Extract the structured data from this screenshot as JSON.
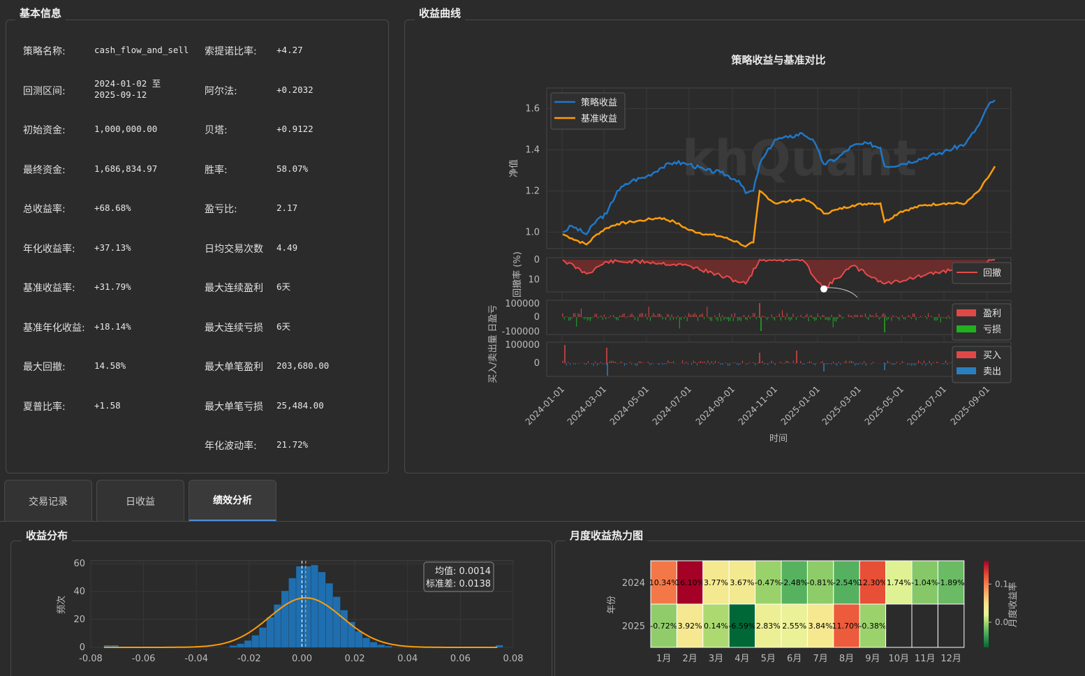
{
  "panels": {
    "basic_title": "基本信息",
    "curve_title": "收益曲线",
    "dist_title": "收益分布",
    "heat_title": "月度收益热力图"
  },
  "stats_left": [
    {
      "label": "策略名称:",
      "value": "cash_flow_and_sell"
    },
    {
      "label": "回测区间:",
      "value": "2024-01-02 至\n2025-09-12"
    },
    {
      "label": "初始资金:",
      "value": "1,000,000.00"
    },
    {
      "label": "最终资金:",
      "value": "1,686,834.97"
    },
    {
      "label": "总收益率:",
      "value": "+68.68%"
    },
    {
      "label": "年化收益率:",
      "value": "+37.13%"
    },
    {
      "label": "基准收益率:",
      "value": "+31.79%"
    },
    {
      "label": "基准年化收益:",
      "value": "+18.14%"
    },
    {
      "label": "最大回撤:",
      "value": "14.58%"
    },
    {
      "label": "夏普比率:",
      "value": "+1.58"
    }
  ],
  "stats_right": [
    {
      "label": "索提诺比率:",
      "value": "+4.27"
    },
    {
      "label": "阿尔法:",
      "value": "+0.2032"
    },
    {
      "label": "贝塔:",
      "value": "+0.9122"
    },
    {
      "label": "胜率:",
      "value": "58.07%"
    },
    {
      "label": "盈亏比:",
      "value": "2.17"
    },
    {
      "label": "日均交易次数",
      "value": "4.49"
    },
    {
      "label": "最大连续盈利",
      "value": "6天"
    },
    {
      "label": "最大连续亏损",
      "value": "6天"
    },
    {
      "label": "最大单笔盈利",
      "value": "203,680.00"
    },
    {
      "label": "最大单笔亏损",
      "value": "25,484.00"
    },
    {
      "label": "年化波动率:",
      "value": "21.72%"
    }
  ],
  "tabs": [
    {
      "label": "交易记录",
      "active": false
    },
    {
      "label": "日收益",
      "active": false
    },
    {
      "label": "绩效分析",
      "active": true
    }
  ],
  "curve_chart": {
    "title": "策略收益与基准对比",
    "watermark": "khQuant",
    "ylabel": "净值",
    "xlabel": "时间",
    "ylim": [
      0.92,
      1.7
    ],
    "yticks": [
      "1.0",
      "1.2",
      "1.4",
      "1.6"
    ],
    "xticks": [
      "2024-01-01",
      "2024-03-01",
      "2024-05-01",
      "2024-07-01",
      "2024-09-01",
      "2024-11-01",
      "2025-01-01",
      "2025-03-01",
      "2025-05-01",
      "2025-07-01",
      "2025-09-01"
    ],
    "legend": [
      "策略收益",
      "基准收益"
    ],
    "colors": {
      "strategy": "#1f77c8",
      "benchmark": "#ff9d0a",
      "drawdown": "#e84a4a",
      "profit": "#e04848",
      "loss": "#20b020",
      "buy": "#e04848",
      "sell": "#2a7fc0"
    },
    "drawdown_ylabel": "回撤率 (%)",
    "drawdown_yticks": [
      "0",
      "10"
    ],
    "drawdown_legend": "回撤",
    "pnl_ylabel": "日盈亏",
    "pnl_yticks": [
      "100000",
      "0",
      "-100000"
    ],
    "pnl_legend": [
      "盈利",
      "亏损"
    ],
    "vol_ylabel": "买入/卖出量",
    "vol_yticks": [
      "100000",
      "0"
    ],
    "vol_legend": [
      "买入",
      "卖出"
    ]
  },
  "chart_data": [
    {
      "type": "line",
      "title": "策略收益与基准对比",
      "xlabel": "时间",
      "ylabel": "净值",
      "x": [
        "2024-01-02",
        "2024-01-15",
        "2024-02-05",
        "2024-02-20",
        "2024-03-05",
        "2024-03-20",
        "2024-04-10",
        "2024-05-01",
        "2024-05-20",
        "2024-06-10",
        "2024-07-01",
        "2024-07-25",
        "2024-08-15",
        "2024-09-10",
        "2024-09-20",
        "2024-10-01",
        "2024-10-10",
        "2024-11-01",
        "2024-11-20",
        "2024-12-10",
        "2024-12-25",
        "2025-01-10",
        "2025-01-30",
        "2025-02-20",
        "2025-03-15",
        "2025-04-01",
        "2025-04-07",
        "2025-04-30",
        "2025-06-01",
        "2025-07-01",
        "2025-08-01",
        "2025-08-20",
        "2025-09-05",
        "2025-09-12"
      ],
      "series": [
        {
          "name": "策略收益",
          "values": [
            1.0,
            1.03,
            0.99,
            1.06,
            1.09,
            1.2,
            1.25,
            1.27,
            1.31,
            1.34,
            1.33,
            1.3,
            1.29,
            1.25,
            1.19,
            1.2,
            1.33,
            1.45,
            1.46,
            1.48,
            1.45,
            1.33,
            1.36,
            1.42,
            1.43,
            1.41,
            1.32,
            1.33,
            1.36,
            1.39,
            1.43,
            1.52,
            1.63,
            1.64
          ]
        },
        {
          "name": "基准收益",
          "values": [
            0.99,
            0.97,
            0.94,
            0.99,
            1.02,
            1.04,
            1.05,
            1.06,
            1.07,
            1.05,
            1.01,
            0.99,
            0.98,
            0.95,
            0.93,
            0.95,
            1.2,
            1.14,
            1.15,
            1.16,
            1.14,
            1.09,
            1.11,
            1.13,
            1.14,
            1.14,
            1.05,
            1.1,
            1.13,
            1.14,
            1.14,
            1.2,
            1.28,
            1.32
          ]
        }
      ],
      "ylim": [
        0.92,
        1.7
      ],
      "legend_position": "top-left",
      "grid": true
    },
    {
      "type": "area",
      "ylabel": "回撤率 (%)",
      "x": [
        "2024-01-02",
        "2024-02-05",
        "2024-03-05",
        "2024-05-01",
        "2024-07-01",
        "2024-09-20",
        "2024-10-10",
        "2024-12-10",
        "2025-01-10",
        "2025-02-20",
        "2025-04-07",
        "2025-06-01",
        "2025-08-20",
        "2025-09-12"
      ],
      "series": [
        {
          "name": "回撤",
          "values": [
            0,
            7,
            1,
            1,
            3,
            12,
            0,
            0,
            14.58,
            3,
            12,
            8,
            2,
            0
          ]
        }
      ],
      "ylim": [
        0,
        15
      ],
      "grid": true
    },
    {
      "type": "histogram",
      "title": "收益分布",
      "ylabel": "频次",
      "x": [
        -0.075,
        -0.04,
        -0.03,
        -0.02,
        -0.015,
        -0.01,
        -0.005,
        0.0,
        0.005,
        0.01,
        0.015,
        0.02,
        0.03,
        0.074
      ],
      "values": [
        1,
        1,
        3,
        8,
        15,
        25,
        38,
        58,
        45,
        25,
        12,
        7,
        2,
        2
      ],
      "mean": 0.0014,
      "std": 0.0138,
      "annotation": [
        "均值: 0.0014",
        "标准差: 0.0138"
      ],
      "xticks": [
        "-0.08",
        "-0.06",
        "-0.04",
        "-0.02",
        "0.00",
        "0.02",
        "0.04",
        "0.06",
        "0.08"
      ],
      "yticks": [
        "0",
        "20",
        "40",
        "60"
      ],
      "xlim": [
        -0.08,
        0.08
      ],
      "ylim": [
        0,
        60
      ]
    },
    {
      "type": "heatmap",
      "title": "月度收益热力图",
      "ylabel": "年份",
      "colorbar_label": "月度收益率",
      "colorbar_ticks": [
        "0.1",
        "0.0"
      ],
      "columns": [
        "1月",
        "2月",
        "3月",
        "4月",
        "5月",
        "6月",
        "7月",
        "8月",
        "9月",
        "10月",
        "11月",
        "12月"
      ],
      "rows": [
        "2024",
        "2025"
      ],
      "values": [
        [
          0.1034,
          0.161,
          0.0377,
          0.0367,
          -0.0047,
          -0.0248,
          -0.0081,
          -0.0254,
          0.123,
          0.0174,
          -0.0104,
          -0.0189
        ],
        [
          -0.0072,
          0.0392,
          0.0014,
          -0.0659,
          0.0283,
          0.0255,
          0.0384,
          0.117,
          -0.0038,
          null,
          null,
          null
        ]
      ],
      "labels": [
        [
          "10.34%",
          "16.10%",
          "3.77%",
          "3.67%",
          "-0.47%",
          "-2.48%",
          "-0.81%",
          "-2.54%",
          "12.30%",
          "1.74%",
          "-1.04%",
          "-1.89%"
        ],
        [
          "-0.72%",
          "3.92%",
          "0.14%",
          "-6.59%",
          "2.83%",
          "2.55%",
          "3.84%",
          "11.70%",
          "-0.38%",
          "",
          "",
          ""
        ]
      ]
    }
  ]
}
